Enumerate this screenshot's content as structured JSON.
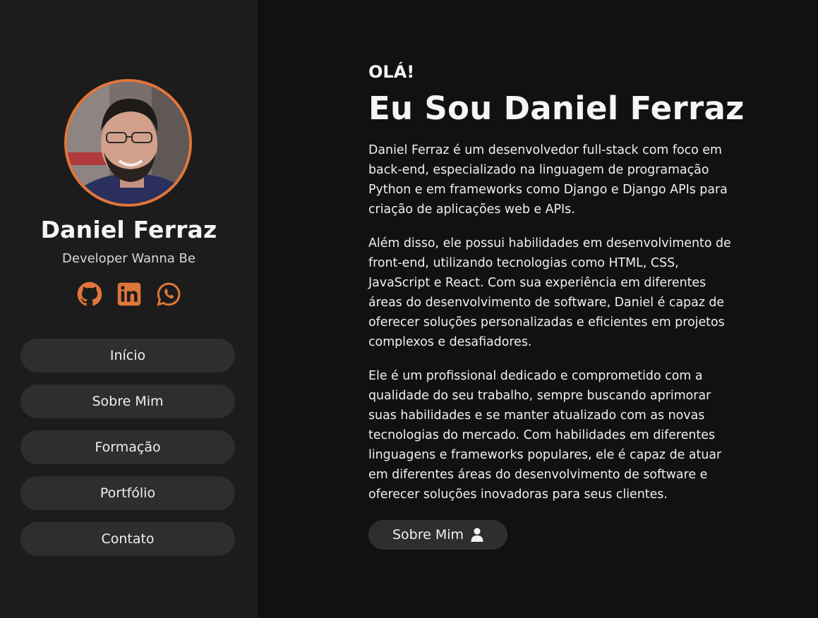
{
  "profile": {
    "name": "Daniel Ferraz",
    "role": "Developer Wanna Be",
    "accent_color": "#e0763a",
    "socials": [
      {
        "icon": "github-icon"
      },
      {
        "icon": "linkedin-icon"
      },
      {
        "icon": "whatsapp-icon"
      }
    ]
  },
  "nav": {
    "items": [
      {
        "label": "Início"
      },
      {
        "label": "Sobre Mim"
      },
      {
        "label": "Formação"
      },
      {
        "label": "Portfólio"
      },
      {
        "label": "Contato"
      }
    ]
  },
  "main": {
    "greeting": "OLÁ!",
    "title": "Eu Sou Daniel Ferraz",
    "paragraphs": [
      "Daniel Ferraz é um desenvolvedor full-stack com foco em back-end, especializado na linguagem de programação Python e em frameworks como Django e Django APIs para criação de aplicações web e APIs.",
      "Além disso, ele possui habilidades em desenvolvimento de front-end, utilizando tecnologias como HTML, CSS, JavaScript e React. Com sua experiência em diferentes áreas do desenvolvimento de software, Daniel é capaz de oferecer soluções personalizadas e eficientes em projetos complexos e desafiadores.",
      "Ele é um profissional dedicado e comprometido com a qualidade do seu trabalho, sempre buscando aprimorar suas habilidades e se manter atualizado com as novas tecnologias do mercado. Com habilidades em diferentes linguagens e frameworks populares, ele é capaz de atuar em diferentes áreas do desenvolvimento de software e oferecer soluções inovadoras para seus clientes."
    ],
    "cta": {
      "label": "Sobre Mim",
      "icon": "user-icon"
    }
  }
}
